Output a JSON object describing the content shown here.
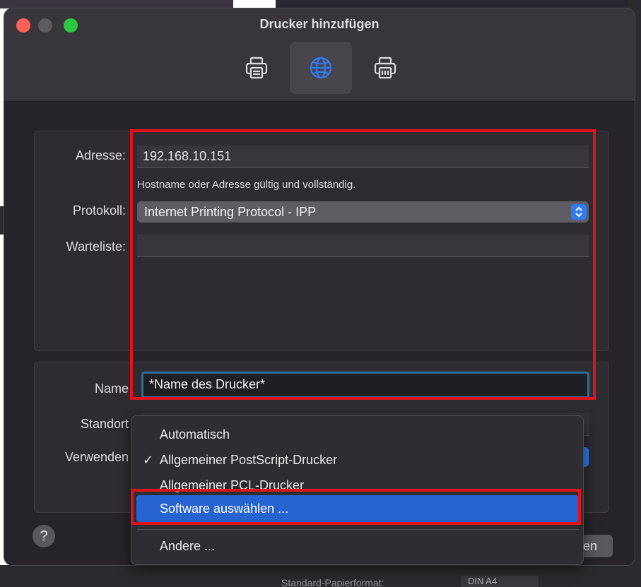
{
  "window": {
    "title": "Drucker hinzufügen"
  },
  "toolbar": {
    "items": [
      {
        "name": "default-printer",
        "icon": "printer-icon",
        "selected": false
      },
      {
        "name": "ip-printer",
        "icon": "globe-icon",
        "selected": true
      },
      {
        "name": "windows-printer",
        "icon": "printer-network-icon",
        "selected": false
      }
    ]
  },
  "form": {
    "address_label": "Adresse:",
    "address_value": "192.168.10.151",
    "address_hint": "Hostname oder Adresse gültig und vollständig.",
    "protocol_label": "Protokoll:",
    "protocol_value": "Internet Printing Protocol - IPP",
    "queue_label": "Warteliste:",
    "queue_value": "",
    "name_label": "Name",
    "name_value": "*Name des Drucker*",
    "location_label": "Standort",
    "use_label": "Verwenden"
  },
  "menu": {
    "items": [
      {
        "label": "Automatisch",
        "checked": false,
        "highlighted": false
      },
      {
        "label": "Allgemeiner PostScript-Drucker",
        "checked": true,
        "highlighted": false
      },
      {
        "label": "Allgemeiner PCL-Drucker",
        "checked": false,
        "highlighted": false
      },
      {
        "label": "Software auswählen ...",
        "checked": false,
        "highlighted": true
      },
      {
        "label": "Andere ...",
        "checked": false,
        "highlighted": false
      }
    ],
    "check_glyph": "✓"
  },
  "footer": {
    "help_label": "?",
    "add_label_fragment": "en"
  },
  "background": {
    "bottom_text": "Standard-Papierformat:",
    "bottom_value": "DIN A4"
  },
  "colors": {
    "accent": "#2f7bf5",
    "highlight": "#2563d1",
    "annotation_red": "#e0131b"
  }
}
